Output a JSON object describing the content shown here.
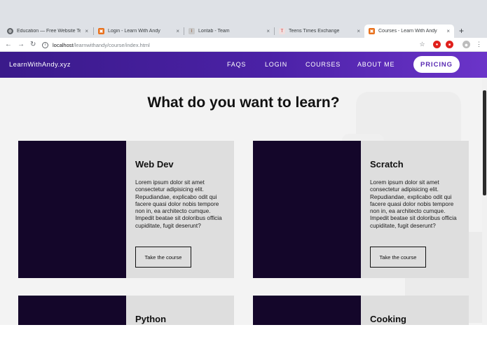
{
  "browser": {
    "tabs": [
      {
        "title": "Education — Free Website Tem",
        "icon": "globe-icon",
        "active": false
      },
      {
        "title": "Login - Learn With Andy",
        "icon": "site-favicon-icon",
        "active": false
      },
      {
        "title": "Lontab - Team",
        "icon": "lontab-favicon-icon",
        "active": false
      },
      {
        "title": "Teens Times Exchange",
        "icon": "tte-favicon-icon",
        "active": false
      },
      {
        "title": "Courses - Learn With Andy",
        "icon": "site-favicon-icon",
        "active": true
      }
    ],
    "close_glyph": "×",
    "new_tab_glyph": "+",
    "url_host": "localhost",
    "url_path": "/learnwithandy/course/index.html"
  },
  "nav": {
    "brand": "LearnWithAndy.xyz",
    "links": [
      "FAQS",
      "LOGIN",
      "COURSES",
      "ABOUT ME"
    ],
    "pricing": "PRICING"
  },
  "main": {
    "headline": "What do you want to learn?",
    "courses": [
      {
        "title": "Web Dev",
        "description": "Lorem ipsum dolor sit amet consectetur adipisicing elit. Repudiandae, explicabo odit qui facere quasi dolor nobis tempore non in, ea architecto cumque. Impedit beatae sit doloribus officia cupiditate, fugit deserunt?",
        "button": "Take the course"
      },
      {
        "title": "Scratch",
        "description": "Lorem ipsum dolor sit amet consectetur adipisicing elit. Repudiandae, explicabo odit qui facere quasi dolor nobis tempore non in, ea architecto cumque. Impedit beatae sit doloribus officia cupiditate, fugit deserunt?",
        "button": "Take the course"
      },
      {
        "title": "Python"
      },
      {
        "title": "Cooking"
      }
    ]
  },
  "colors": {
    "nav_gradient_start": "#3a1a8a",
    "nav_gradient_end": "#6b34c9",
    "card_bg": "#dedede",
    "thumb_bg": "#14062a",
    "page_bg": "#f3f3f3"
  }
}
